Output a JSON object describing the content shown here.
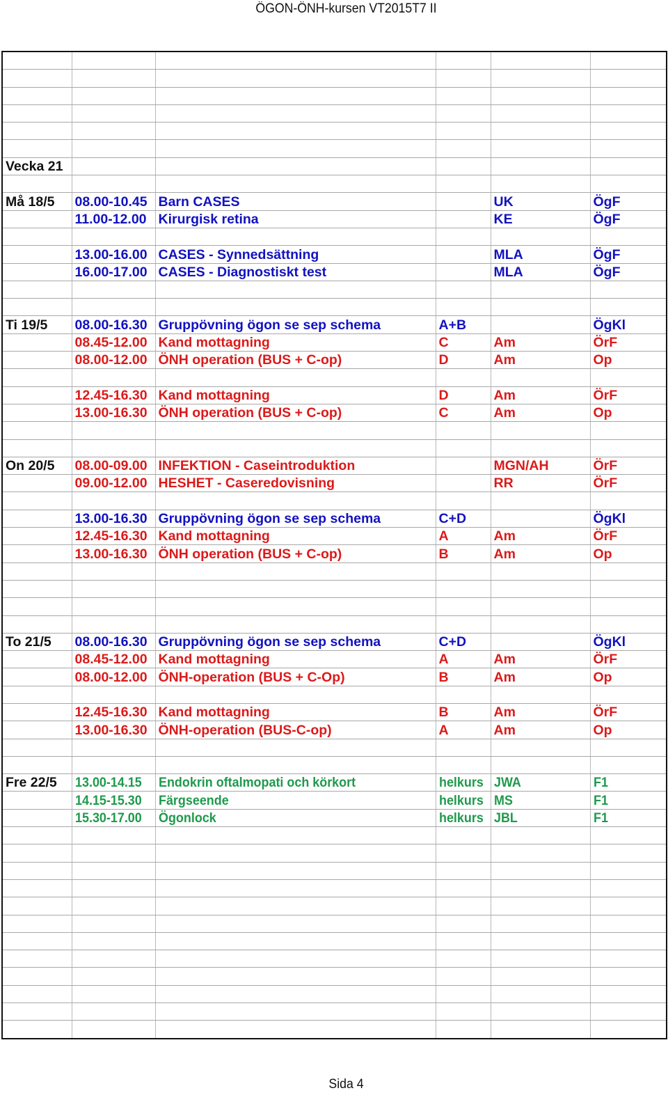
{
  "header": {
    "title": "ÖGON-ÖNH-kursen VT2015T7 II"
  },
  "footer": {
    "page_label": "Sida 4"
  },
  "colors": {
    "blue": "#1212c0",
    "red": "#dc1a1a",
    "green": "#1f9a4c",
    "text": "#111111"
  },
  "schedule": {
    "week_label": "Vecka 21",
    "total_rows": 56,
    "rows": [
      {
        "row": 7,
        "cells": [
          {
            "text": "Vecka 21",
            "style": "week"
          }
        ]
      },
      {
        "row": 9,
        "day": "Må 18/5",
        "color": "blue",
        "time": "08.00-10.45",
        "activity": "Barn  CASES",
        "group": "",
        "teacher": "UK",
        "place": "ÖgF"
      },
      {
        "row": 10,
        "day": "",
        "color": "blue",
        "time": "11.00-12.00",
        "activity": "Kirurgisk retina",
        "group": "",
        "teacher": "KE",
        "place": "ÖgF"
      },
      {
        "row": 12,
        "day": "",
        "color": "blue",
        "time": "13.00-16.00",
        "activity": "CASES   - Synnedsättning",
        "group": "",
        "teacher": "MLA",
        "place": "ÖgF"
      },
      {
        "row": 13,
        "day": "",
        "color": "blue",
        "time": "16.00-17.00",
        "activity": "CASES   -  Diagnostiskt test",
        "group": "",
        "teacher": "MLA",
        "place": "ÖgF"
      },
      {
        "row": 16,
        "day": "Ti 19/5",
        "color": "blue",
        "time": "08.00-16.30",
        "activity": "Gruppövning ögon se sep schema",
        "group": "A+B",
        "teacher": "",
        "place": "ÖgKl"
      },
      {
        "row": 17,
        "day": "",
        "color": "red",
        "time": "08.45-12.00",
        "activity": "Kand mottagning",
        "group": "C",
        "teacher": "Am",
        "place": "ÖrF"
      },
      {
        "row": 18,
        "day": "",
        "color": "red",
        "time": "08.00-12.00",
        "activity": "ÖNH operation (BUS + C-op)",
        "group": "D",
        "teacher": "Am",
        "place": "Op"
      },
      {
        "row": 20,
        "day": "",
        "color": "red",
        "time": "12.45-16.30",
        "activity": "Kand mottagning",
        "group": "D",
        "teacher": "Am",
        "place": "ÖrF"
      },
      {
        "row": 21,
        "day": "",
        "color": "red",
        "time": "13.00-16.30",
        "activity": "ÖNH operation (BUS + C-op)",
        "group": "C",
        "teacher": "Am",
        "place": "Op"
      },
      {
        "row": 24,
        "day": "On 20/5",
        "color": "red",
        "time": "08.00-09.00",
        "activity": "INFEKTION - Caseintroduktion",
        "activity_small": true,
        "group": "",
        "teacher": "MGN/AH",
        "place": "ÖrF"
      },
      {
        "row": 25,
        "day": "",
        "color": "red",
        "time": "09.00-12.00",
        "activity": "HESHET - Caseredovisning",
        "activity_small": true,
        "group": "",
        "teacher": "RR",
        "place": "ÖrF"
      },
      {
        "row": 27,
        "day": "",
        "color": "blue",
        "time": "13.00-16.30",
        "activity": "Gruppövning ögon se sep schema",
        "group": "C+D",
        "teacher": "",
        "place": "ÖgKl"
      },
      {
        "row": 28,
        "day": "",
        "color": "red",
        "time": "12.45-16.30",
        "activity": "Kand mottagning",
        "group": "A",
        "teacher": "Am",
        "teacher_small": true,
        "place": "ÖrF"
      },
      {
        "row": 29,
        "day": "",
        "color": "red",
        "time": "13.00-16.30",
        "activity": "ÖNH operation (BUS + C-op)",
        "group": "B",
        "teacher": "Am",
        "place": "Op",
        "place_small": true
      },
      {
        "row": 34,
        "day": "To 21/5",
        "color": "blue",
        "time": "08.00-16.30",
        "activity": "Gruppövning ögon se sep schema",
        "group": "C+D",
        "teacher": "",
        "place": "ÖgKl"
      },
      {
        "row": 35,
        "day": "",
        "color": "red",
        "time": "08.45-12.00",
        "activity": "Kand mottagning",
        "group": "A",
        "teacher": "Am",
        "place": "ÖrF"
      },
      {
        "row": 36,
        "day": "",
        "color": "red",
        "time": "08.00-12.00",
        "activity": "ÖNH-operation (BUS + C-Op)",
        "group": "B",
        "teacher": "Am",
        "teacher_small": true,
        "place": "Op"
      },
      {
        "row": 38,
        "day": "",
        "color": "red",
        "time": "12.45-16.30",
        "activity": "Kand mottagning",
        "group": "B",
        "teacher": "Am",
        "place": "ÖrF"
      },
      {
        "row": 39,
        "day": "",
        "color": "red",
        "time": "13.00-16.30",
        "activity": "ÖNH-operation (BUS-C-op)",
        "group": "A",
        "teacher": "Am",
        "place": "Op"
      },
      {
        "row": 42,
        "day": "Fre 22/5",
        "color": "green",
        "time": "13.00-14.15",
        "activity": "Endokrin oftalmopati och körkort",
        "group": "helkurs",
        "teacher": "JWA",
        "place": "F1"
      },
      {
        "row": 43,
        "day": "",
        "color": "green",
        "time": "14.15-15.30",
        "activity": "Färgseende",
        "group": "helkurs",
        "teacher": "MS",
        "place": "F1"
      },
      {
        "row": 44,
        "day": "",
        "color": "green",
        "time": "15.30-17.00",
        "activity": "Ögonlock",
        "group": "helkurs",
        "teacher": "JBL",
        "place": "F1"
      }
    ]
  }
}
